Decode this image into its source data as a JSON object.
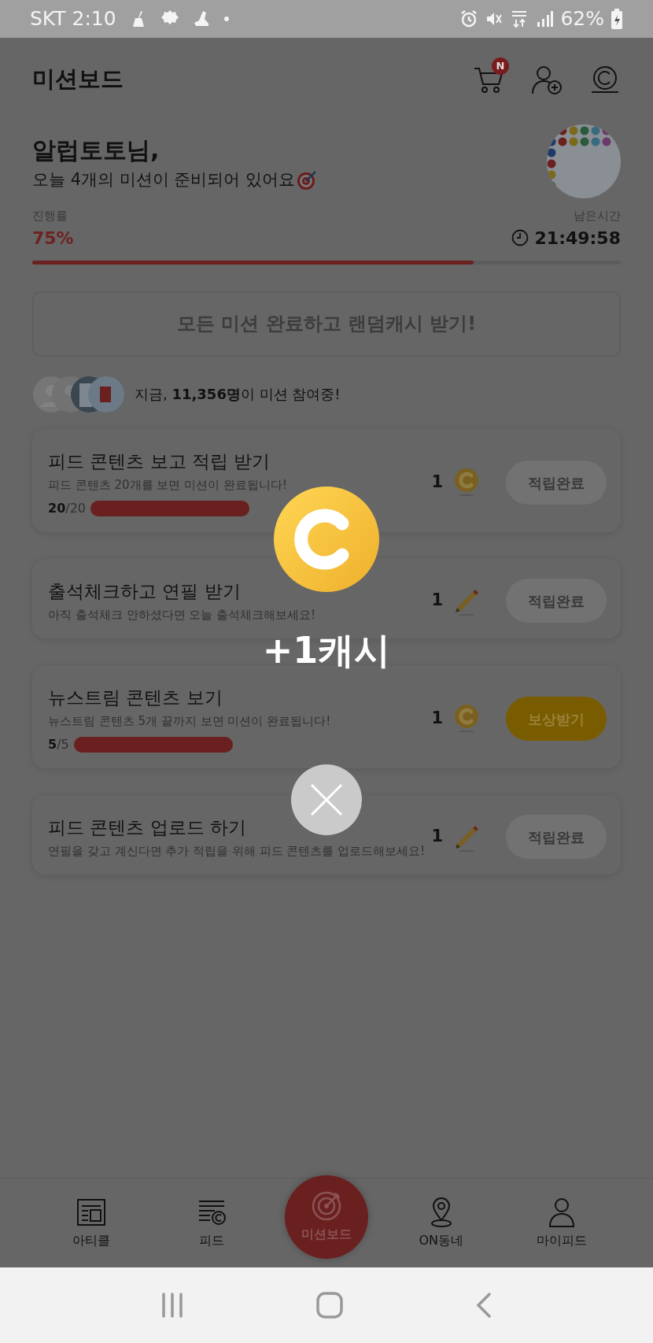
{
  "status_bar": {
    "carrier_time": "SKT 2:10",
    "battery": "62%"
  },
  "header": {
    "title": "미션보드",
    "cart_badge": "N"
  },
  "greeting": {
    "name": "알럽토토님,",
    "message": "오늘 4개의 미션이 준비되어 있어요"
  },
  "progress": {
    "label": "진행률",
    "value": "75%",
    "level": 0.75,
    "remaining_label": "남은시간",
    "remaining_time": "21:49:58"
  },
  "all_complete_button": {
    "label": "모든 미션 완료하고 랜덤캐시 받기!",
    "disabled": true
  },
  "participants": {
    "text": "지금, **11,356명**이 미션 참여중!"
  },
  "missions": [
    {
      "title": "피드 콘텐츠 보고 적립 받기",
      "description": "피드 콘텐츠 20개를 보면 미션이 완료됩니다!",
      "progress": {
        "text": "**20**/20",
        "level": 1
      },
      "reward": {
        "amount": "1",
        "kind": "cash"
      },
      "button": {
        "label": "적립완료",
        "kind": "done"
      }
    },
    {
      "title": "출석체크하고 연필 받기",
      "description": "아직 출석체크 안하셨다면 오늘 출석체크해보세요!",
      "reward": {
        "amount": "1",
        "kind": "pencil"
      },
      "button": {
        "label": "적립완료",
        "kind": "done"
      }
    },
    {
      "title": "뉴스트림 콘텐츠 보기",
      "description": "뉴스트림 콘텐츠 5개 끝까지 보면 미션이 완료됩니다!",
      "progress": {
        "text": "**5**/5",
        "level": 1
      },
      "reward": {
        "amount": "1",
        "kind": "cash"
      },
      "button": {
        "label": "보상받기",
        "kind": "claim"
      }
    },
    {
      "title": "피드 콘텐츠 업로드 하기",
      "description": "연필을 갖고 계신다면 추가 적립을 위해 피드 콘텐츠를 업로드해보세요!",
      "reward": {
        "amount": "1",
        "kind": "pencil"
      },
      "button": {
        "label": "적립완료",
        "kind": "done"
      }
    }
  ],
  "popup": {
    "amount": "+1캐시"
  },
  "bottom_nav": [
    {
      "label": "아티클",
      "selected": false
    },
    {
      "label": "피드",
      "selected": false
    },
    {
      "label": "미션보드",
      "selected": true
    },
    {
      "label": "ON동네",
      "selected": false
    },
    {
      "label": "마이피드",
      "selected": false
    }
  ]
}
